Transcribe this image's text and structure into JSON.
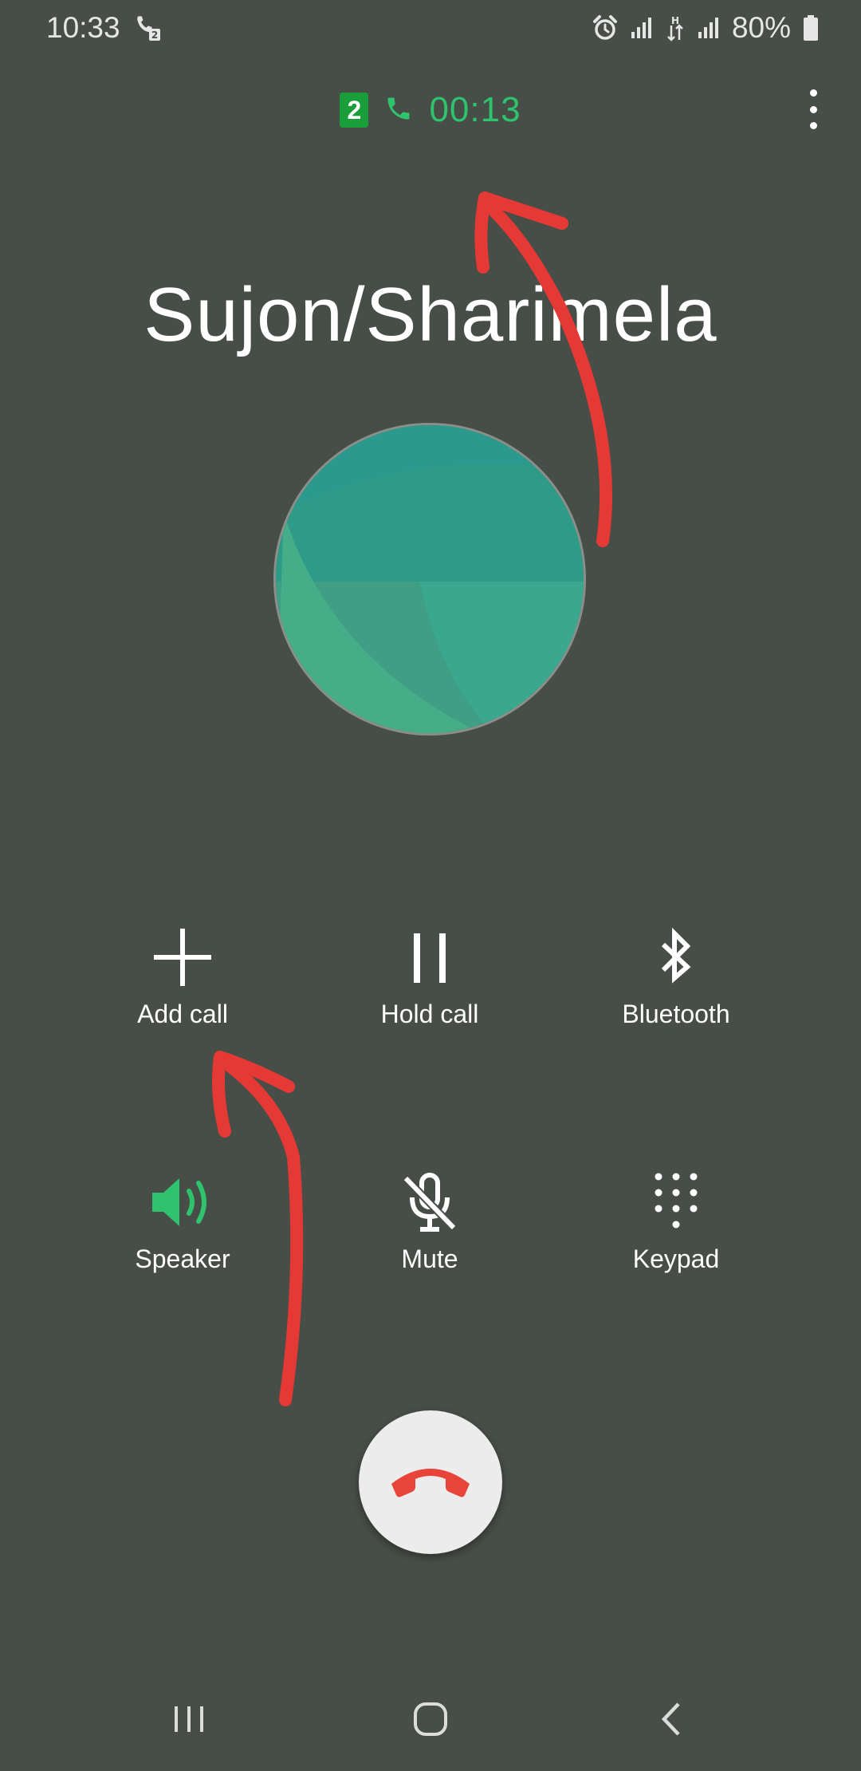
{
  "status_bar": {
    "time": "10:33",
    "battery": "80%",
    "icons": [
      "call-sim2-icon",
      "alarm-icon",
      "signal-icon",
      "data-h-icon",
      "signal-icon",
      "battery-icon"
    ]
  },
  "call": {
    "sim_slot": "2",
    "timer": "00:13",
    "contact_name": "Sujon/Sharimela"
  },
  "actions": [
    {
      "id": "add-call",
      "label": "Add call",
      "icon": "plus-icon"
    },
    {
      "id": "hold-call",
      "label": "Hold call",
      "icon": "pause-icon"
    },
    {
      "id": "bluetooth",
      "label": "Bluetooth",
      "icon": "bluetooth-icon"
    },
    {
      "id": "speaker",
      "label": "Speaker",
      "icon": "speaker-icon"
    },
    {
      "id": "mute",
      "label": "Mute",
      "icon": "mic-off-icon"
    },
    {
      "id": "keypad",
      "label": "Keypad",
      "icon": "keypad-icon"
    }
  ],
  "colors": {
    "background": "#474d47",
    "accent_green": "#2fc36d",
    "end_call_red": "#e8443a",
    "annotation_red": "#e53935"
  },
  "nav_bar": {
    "icons": [
      "recents-icon",
      "home-icon",
      "back-icon"
    ]
  }
}
